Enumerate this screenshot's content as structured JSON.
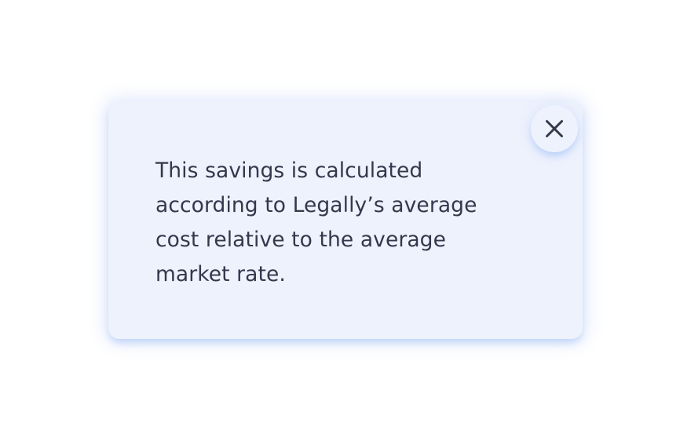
{
  "tooltip": {
    "text": "This savings is calculated according to Legally’s average cost relative to the average market rate.",
    "close_icon": "close-icon"
  },
  "colors": {
    "card_background": "#eef2fd",
    "text": "#33384c",
    "close_icon": "#33384c",
    "glow": "#96b9f5"
  }
}
